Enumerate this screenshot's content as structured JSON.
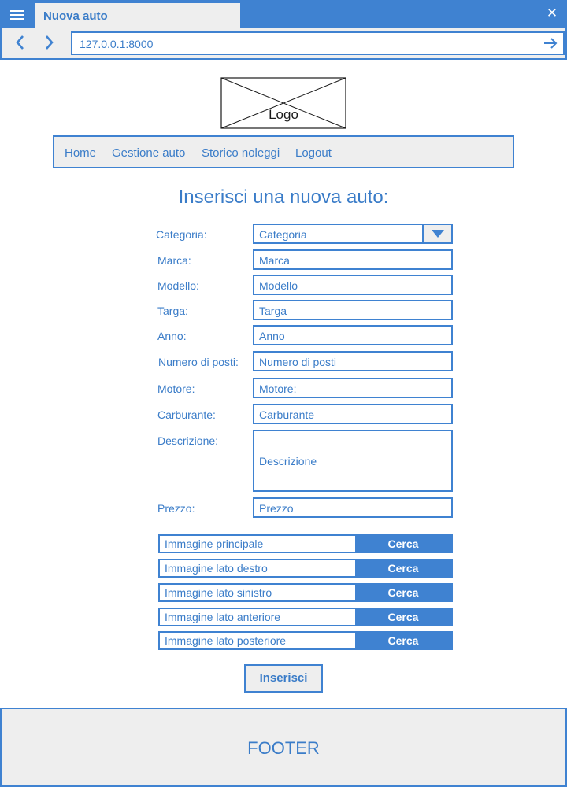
{
  "browser": {
    "tab_title": "Nuova auto",
    "url": "127.0.0.1:8000",
    "icons": [
      "menu-icon",
      "close-icon",
      "back-icon",
      "forward-icon",
      "go-arrow-icon"
    ]
  },
  "logo": {
    "label": "Logo"
  },
  "nav": {
    "items": [
      {
        "label": "Home"
      },
      {
        "label": "Gestione auto"
      },
      {
        "label": "Storico noleggi"
      },
      {
        "label": "Logout"
      }
    ]
  },
  "page_title": "Inserisci una nuova auto:",
  "form": {
    "categoria": {
      "label": "Categoria:",
      "value": "Categoria"
    },
    "marca": {
      "label": "Marca:",
      "placeholder": "Marca"
    },
    "modello": {
      "label": "Modello:",
      "placeholder": "Modello"
    },
    "targa": {
      "label": "Targa:",
      "placeholder": "Targa"
    },
    "anno": {
      "label": "Anno:",
      "placeholder": "Anno"
    },
    "posti": {
      "label": "Numero di posti:",
      "placeholder": "Numero di posti"
    },
    "motore": {
      "label": "Motore:",
      "placeholder": "Motore:"
    },
    "carburante": {
      "label": "Carburante:",
      "placeholder": "Carburante"
    },
    "descrizione": {
      "label": "Descrizione:",
      "placeholder": "Descrizione"
    },
    "prezzo": {
      "label": "Prezzo:",
      "placeholder": "Prezzo"
    }
  },
  "images": {
    "button_label": "Cerca",
    "rows": [
      {
        "label": "Immagine principale"
      },
      {
        "label": "Immagine lato destro"
      },
      {
        "label": "Immagine lato sinistro"
      },
      {
        "label": "Immagine lato anteriore"
      },
      {
        "label": "Immagine lato posteriore"
      }
    ]
  },
  "submit_label": "Inserisci",
  "footer_label": "FOOTER",
  "colors": {
    "accent": "#3f82d1",
    "text": "#3a7cc8",
    "panel": "#eeeeee"
  }
}
